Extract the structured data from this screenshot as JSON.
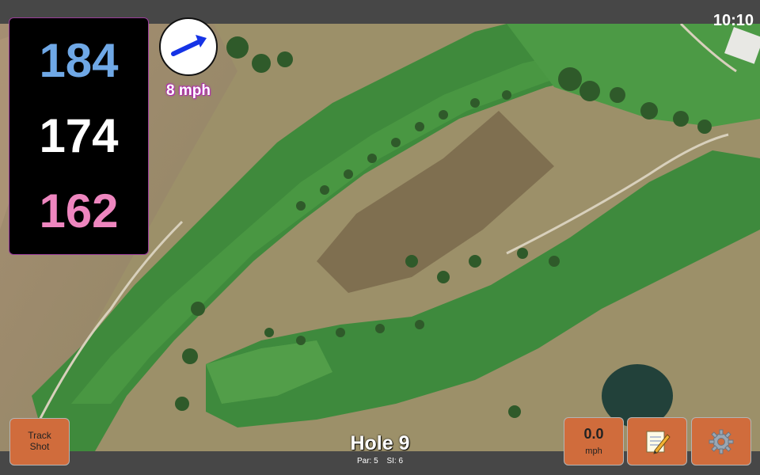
{
  "status_bar": {
    "time": "10:10"
  },
  "distances": {
    "back": {
      "value": "184",
      "color": "#6fa8e6"
    },
    "middle": {
      "value": "174",
      "color": "#ffffff"
    },
    "front": {
      "value": "162",
      "color": "#ee86bf"
    }
  },
  "wind": {
    "speed_label": "8 mph",
    "direction_icon": "arrow-icon",
    "arrow_color": "#1533e6"
  },
  "map": {
    "description_icon": "aerial-golf-course-map"
  },
  "hole": {
    "title": "Hole 9",
    "par_label": "Par: 5",
    "si_label": "SI: 6"
  },
  "buttons": {
    "track_shot": {
      "line1": "Track",
      "line2": "Shot"
    },
    "speed": {
      "value": "0.0",
      "unit": "mph"
    },
    "notes": {
      "icon": "notepad-pencil-icon"
    },
    "settings": {
      "icon": "gear-icon"
    }
  },
  "colors": {
    "button_bg": "#d06c3c",
    "bar_bg": "#474747",
    "panel_bg": "#000000",
    "panel_border": "#9b3c9b"
  }
}
